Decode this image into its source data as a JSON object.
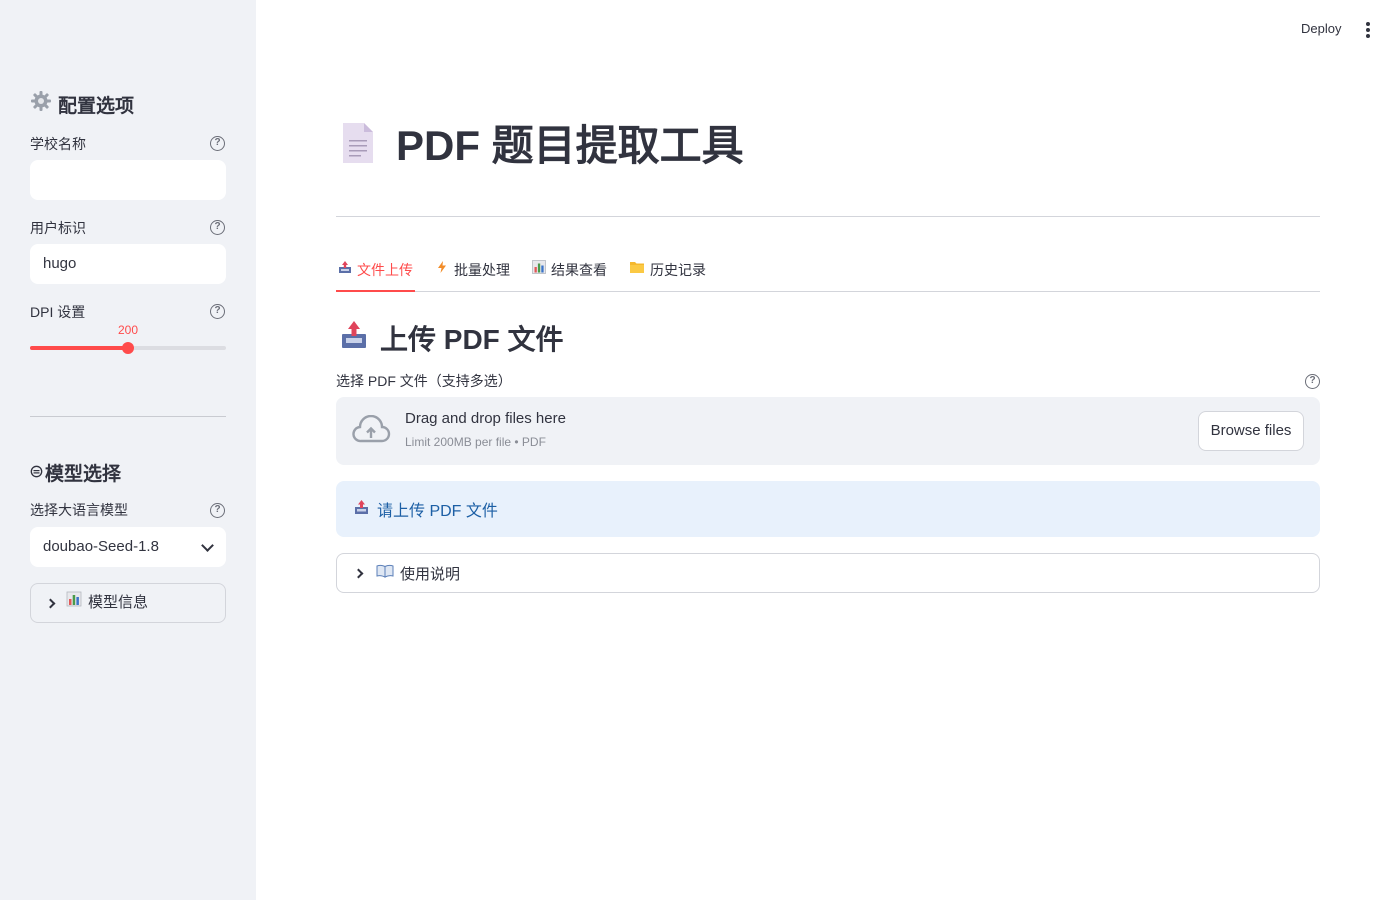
{
  "sidebar": {
    "config_heading": "配置选项",
    "school_label": "学校名称",
    "school_value": "",
    "user_label": "用户标识",
    "user_value": "hugo",
    "dpi_label": "DPI 设置",
    "dpi_value": "200",
    "dpi_fraction": 0.5,
    "model_heading": "模型选择",
    "model_select_label": "选择大语言模型",
    "model_selected": "doubao-Seed-1.8",
    "model_info_label": "模型信息"
  },
  "header": {
    "deploy_label": "Deploy"
  },
  "main": {
    "title": "PDF 题目提取工具",
    "tabs": [
      {
        "label": "文件上传",
        "icon": "inbox-tray-icon"
      },
      {
        "label": "批量处理",
        "icon": "lightning-icon"
      },
      {
        "label": "结果查看",
        "icon": "bar-chart-icon"
      },
      {
        "label": "历史记录",
        "icon": "folder-icon"
      }
    ],
    "section_title": "上传 PDF 文件",
    "uploader_label": "选择 PDF 文件（支持多选）",
    "dropzone_title": "Drag and drop files here",
    "dropzone_limit": "Limit 200MB per file • PDF",
    "browse_label": "Browse files",
    "info_message": "请上传 PDF 文件",
    "instructions_label": "使用说明"
  },
  "colors": {
    "accent": "#ff4b4b",
    "sidebar_bg": "#f0f2f6",
    "info_bg": "#e8f1fc",
    "info_text": "#1c5fa5"
  }
}
